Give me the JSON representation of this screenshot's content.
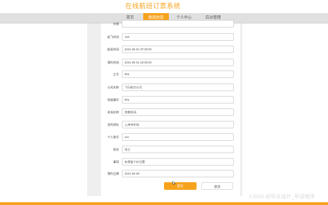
{
  "header": {
    "site_title": "在线航班订票系统"
  },
  "nav": {
    "items": [
      "首页",
      "航班信息",
      "个人中心",
      "后台管理"
    ],
    "active_index": 1
  },
  "form": {
    "fields": [
      {
        "label": "价格",
        "value": ""
      },
      {
        "label": "起飞时间",
        "value": "120"
      },
      {
        "label": "航班时间",
        "value": "2021-05-01 07:00:00"
      },
      {
        "label": "预约时间",
        "value": "2021-05-01 10:00:00"
      },
      {
        "label": "工号",
        "value": "001"
      },
      {
        "label": "公司名称",
        "value": "飞行航空公司"
      },
      {
        "label": "机组编号",
        "value": "001"
      },
      {
        "label": "机场名称",
        "value": "首都机场"
      },
      {
        "label": "目的地址",
        "value": "上海市机场"
      },
      {
        "label": "个人账号",
        "value": "xxx"
      },
      {
        "label": "姓名",
        "value": "张三"
      },
      {
        "label": "事项",
        "value": "有预留个价位置"
      },
      {
        "label": "预约日期",
        "value": "2021-04-29"
      }
    ],
    "submit_label": "提交",
    "cancel_label": "取消"
  },
  "watermark": "CSDN @毕业设计_毕设程序",
  "colors": {
    "accent": "#f7a21c",
    "nav_bg": "#e0e0e0",
    "panel_bg": "#efefef"
  }
}
